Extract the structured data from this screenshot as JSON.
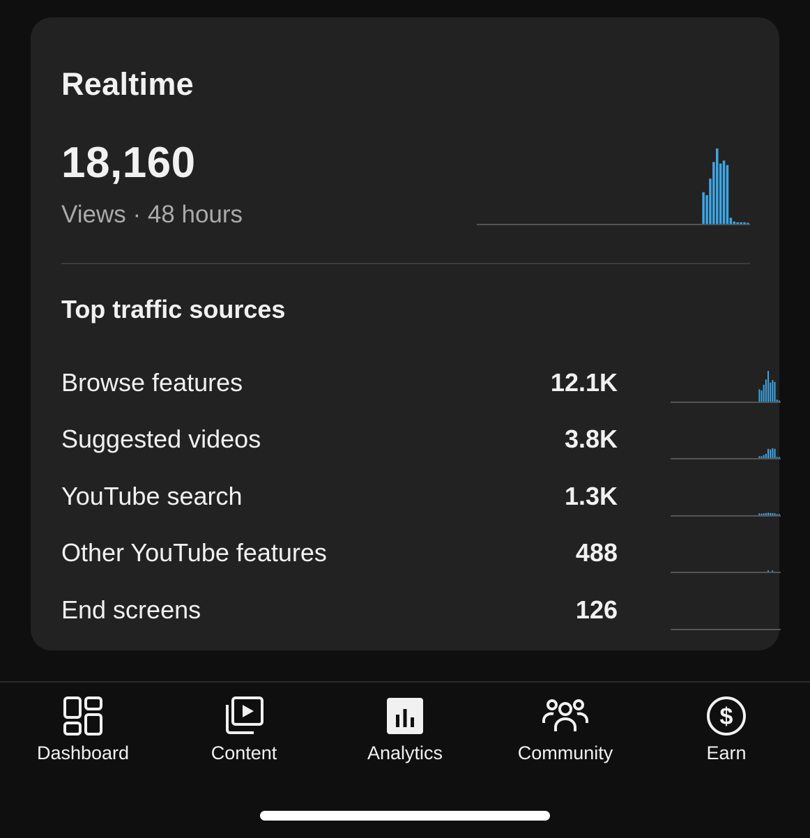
{
  "realtime": {
    "title": "Realtime",
    "views": "18,160",
    "subtitle": "Views · 48 hours",
    "bar_color": "#3ea6e5",
    "spark_values": [
      0,
      0,
      0,
      0,
      0,
      0,
      0,
      0,
      0,
      0,
      0,
      0,
      0,
      0,
      0,
      0,
      0,
      0,
      0,
      0,
      0,
      0,
      0,
      0,
      0,
      0,
      0,
      0,
      0,
      0,
      0,
      0,
      0,
      0,
      0,
      0,
      0,
      0,
      0,
      0,
      0,
      0,
      0,
      0,
      0,
      0,
      0,
      0,
      0,
      0,
      0,
      0,
      0,
      0,
      0,
      0,
      0,
      0,
      0,
      0,
      0,
      0,
      0,
      0,
      0,
      0,
      42,
      38,
      60,
      82,
      100,
      80,
      84,
      78,
      8,
      3,
      2,
      2,
      2,
      1
    ]
  },
  "traffic": {
    "title": "Top traffic sources",
    "items": [
      {
        "label": "Browse features",
        "value": "12.1K",
        "spark": [
          0,
          0,
          0,
          0,
          0,
          0,
          0,
          0,
          0,
          0,
          0,
          0,
          0,
          0,
          0,
          0,
          0,
          0,
          0,
          0,
          0,
          0,
          0,
          0,
          0,
          0,
          0,
          0,
          0,
          0,
          0,
          0,
          0,
          0,
          0,
          0,
          0,
          0,
          0,
          0,
          40,
          36,
          55,
          72,
          100,
          62,
          70,
          64,
          6,
          2
        ]
      },
      {
        "label": "Suggested videos",
        "value": "3.8K",
        "spark": [
          0,
          0,
          0,
          0,
          0,
          0,
          0,
          0,
          0,
          0,
          0,
          0,
          0,
          0,
          0,
          0,
          0,
          0,
          0,
          0,
          0,
          0,
          0,
          0,
          0,
          0,
          0,
          0,
          0,
          0,
          0,
          0,
          0,
          0,
          0,
          0,
          0,
          0,
          0,
          0,
          6,
          6,
          10,
          14,
          30,
          28,
          32,
          30,
          3,
          1
        ]
      },
      {
        "label": "YouTube search",
        "value": "1.3K",
        "spark": [
          0,
          0,
          0,
          0,
          0,
          0,
          0,
          0,
          0,
          0,
          0,
          0,
          0,
          0,
          0,
          0,
          0,
          0,
          0,
          0,
          0,
          0,
          0,
          0,
          0,
          0,
          0,
          0,
          0,
          0,
          0,
          0,
          0,
          0,
          0,
          0,
          0,
          0,
          0,
          0,
          6,
          5,
          6,
          7,
          8,
          7,
          7,
          6,
          2,
          1
        ]
      },
      {
        "label": "Other YouTube features",
        "value": "488",
        "spark": [
          0,
          0,
          0,
          0,
          0,
          0,
          0,
          0,
          0,
          0,
          0,
          0,
          0,
          0,
          0,
          0,
          0,
          0,
          0,
          0,
          0,
          0,
          0,
          0,
          0,
          0,
          0,
          0,
          0,
          0,
          0,
          0,
          0,
          0,
          0,
          0,
          0,
          0,
          0,
          0,
          0,
          0,
          0,
          0,
          4,
          0,
          4,
          0,
          0,
          0
        ]
      },
      {
        "label": "End screens",
        "value": "126",
        "spark": [
          0,
          0,
          0,
          0,
          0,
          0,
          0,
          0,
          0,
          0,
          0,
          0,
          0,
          0,
          0,
          0,
          0,
          0,
          0,
          0,
          0,
          0,
          0,
          0,
          0,
          0,
          0,
          0,
          0,
          0,
          0,
          0,
          0,
          0,
          0,
          0,
          0,
          0,
          0,
          0,
          0,
          0,
          0,
          0,
          0,
          0,
          0,
          0,
          0,
          0
        ]
      }
    ]
  },
  "nav": {
    "items": [
      {
        "label": "Dashboard",
        "icon": "dashboard-icon"
      },
      {
        "label": "Content",
        "icon": "content-icon"
      },
      {
        "label": "Analytics",
        "icon": "analytics-icon",
        "active": true
      },
      {
        "label": "Community",
        "icon": "community-icon"
      },
      {
        "label": "Earn",
        "icon": "earn-icon"
      }
    ]
  }
}
